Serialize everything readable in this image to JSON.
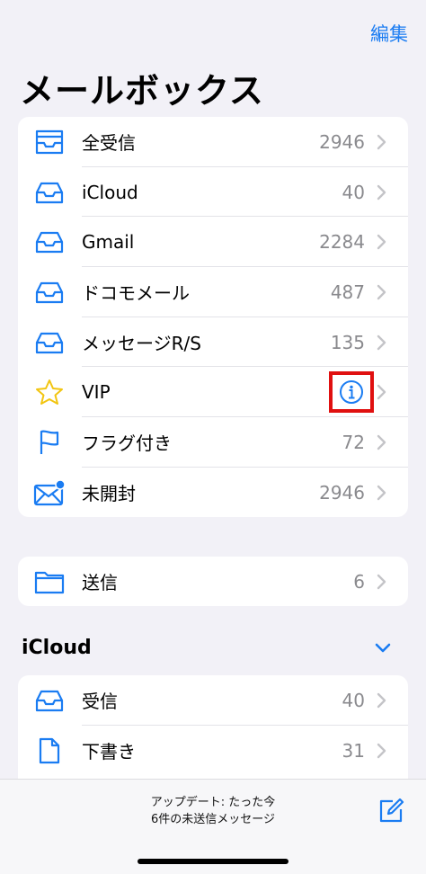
{
  "header": {
    "edit_label": "編集",
    "title": "メールボックス"
  },
  "mailboxes": [
    {
      "icon": "inbox-icon",
      "label": "全受信",
      "count": "2946"
    },
    {
      "icon": "inbox-icon",
      "label": "iCloud",
      "count": "40"
    },
    {
      "icon": "inbox-icon",
      "label": "Gmail",
      "count": "2284"
    },
    {
      "icon": "inbox-icon",
      "label": "ドコモメール",
      "count": "487"
    },
    {
      "icon": "inbox-icon",
      "label": "メッセージR/S",
      "count": "135"
    },
    {
      "icon": "star-icon",
      "label": "VIP",
      "count": ""
    },
    {
      "icon": "flag-icon",
      "label": "フラグ付き",
      "count": "72"
    },
    {
      "icon": "unread-envelope-icon",
      "label": "未開封",
      "count": "2946"
    }
  ],
  "sent_box": {
    "icon": "folder-icon",
    "label": "送信",
    "count": "6"
  },
  "icloud_section": {
    "title": "iCloud",
    "items": [
      {
        "icon": "inbox-icon",
        "label": "受信",
        "count": "40"
      },
      {
        "icon": "draft-icon",
        "label": "下書き",
        "count": "31"
      }
    ]
  },
  "status": {
    "line1": "アップデート: たった今",
    "line2": "6件の未送信メッセージ"
  },
  "colors": {
    "accent": "#1a7cf2",
    "star": "#f2c511",
    "highlight": "#e01010",
    "background": "#f2f1f7"
  }
}
